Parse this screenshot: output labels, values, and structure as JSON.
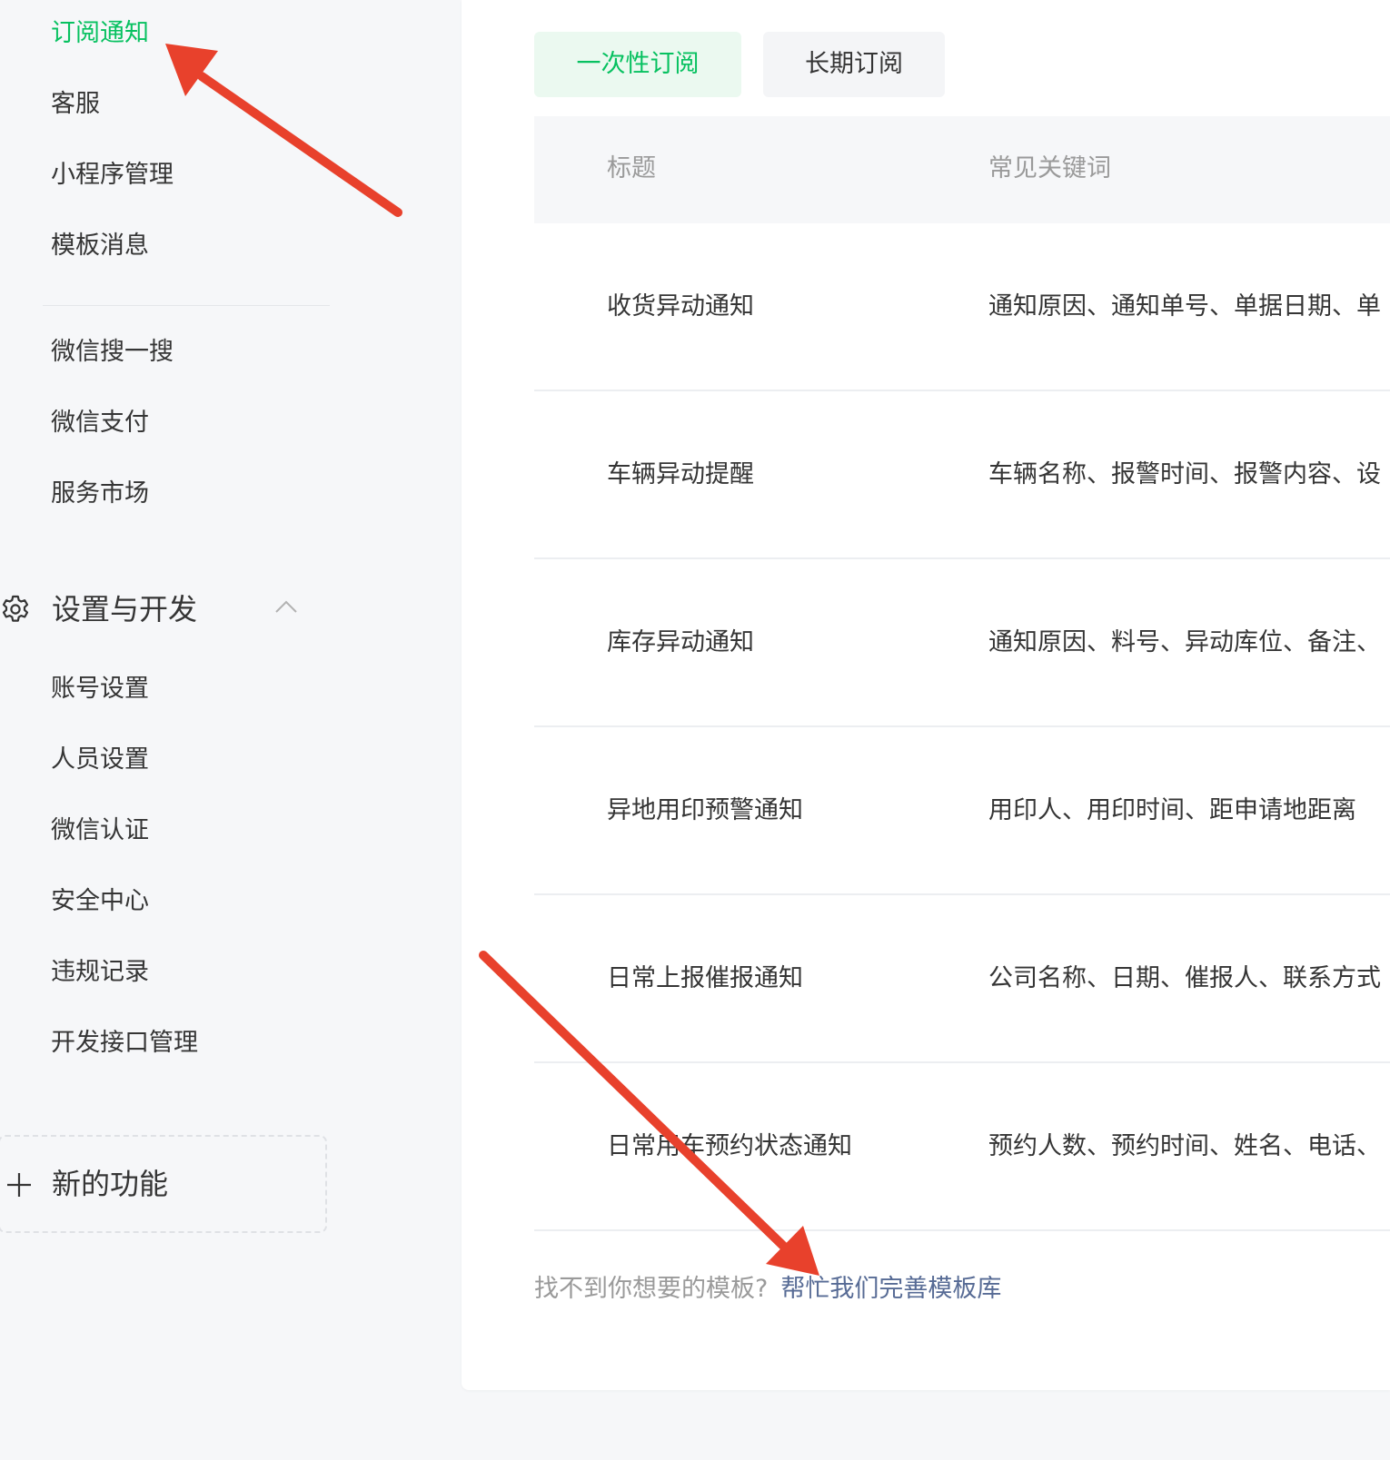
{
  "sidebar": {
    "items_top": [
      {
        "label": "订阅通知",
        "active": true
      },
      {
        "label": "客服"
      },
      {
        "label": "小程序管理"
      },
      {
        "label": "模板消息"
      }
    ],
    "items_mid": [
      {
        "label": "微信搜一搜"
      },
      {
        "label": "微信支付"
      },
      {
        "label": "服务市场"
      }
    ],
    "section": {
      "title": "设置与开发",
      "icon": "gear-icon",
      "expanded": true
    },
    "items_settings": [
      {
        "label": "账号设置"
      },
      {
        "label": "人员设置"
      },
      {
        "label": "微信认证"
      },
      {
        "label": "安全中心"
      },
      {
        "label": "违规记录"
      },
      {
        "label": "开发接口管理"
      }
    ],
    "new_feature": {
      "label": "新的功能",
      "icon": "plus-icon"
    }
  },
  "tabs": [
    {
      "label": "一次性订阅",
      "selected": true
    },
    {
      "label": "长期订阅",
      "selected": false
    }
  ],
  "table": {
    "headers": {
      "title": "标题",
      "keywords": "常见关键词"
    },
    "rows": [
      {
        "title": "收货异动通知",
        "keywords": "通知原因、通知单号、单据日期、单"
      },
      {
        "title": "车辆异动提醒",
        "keywords": "车辆名称、报警时间、报警内容、设"
      },
      {
        "title": "库存异动通知",
        "keywords": "通知原因、料号、异动库位、备注、"
      },
      {
        "title": "异地用印预警通知",
        "keywords": "用印人、用印时间、距申请地距离"
      },
      {
        "title": "日常上报催报通知",
        "keywords": "公司名称、日期、催报人、联系方式"
      },
      {
        "title": "日常用车预约状态通知",
        "keywords": "预约人数、预约时间、姓名、电话、"
      }
    ]
  },
  "footer": {
    "hint": "找不到你想要的模板?",
    "link": "帮忙我们完善模板库"
  },
  "colors": {
    "accent": "#07c160",
    "link": "#576b95",
    "annotation_arrow": "#e8412c"
  }
}
